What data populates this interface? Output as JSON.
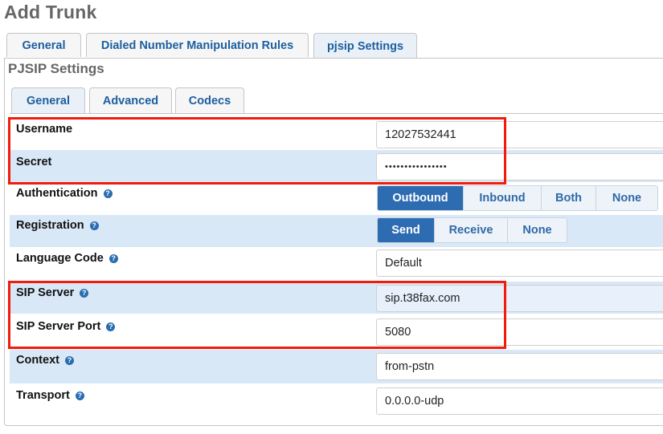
{
  "page": {
    "title": "Add Trunk"
  },
  "top_tabs": [
    {
      "label": "General",
      "active": false
    },
    {
      "label": "Dialed Number Manipulation Rules",
      "active": false
    },
    {
      "label": "pjsip Settings",
      "active": true
    }
  ],
  "section": {
    "title": "PJSIP Settings"
  },
  "inner_tabs": [
    {
      "label": "General",
      "active": true
    },
    {
      "label": "Advanced",
      "active": false
    },
    {
      "label": "Codecs",
      "active": false
    }
  ],
  "fields": {
    "username": {
      "label": "Username",
      "value": "12027532441"
    },
    "secret": {
      "label": "Secret",
      "value": "••••••••••••••••"
    },
    "authentication": {
      "label": "Authentication",
      "help": "?",
      "options": [
        "Outbound",
        "Inbound",
        "Both",
        "None"
      ],
      "selected": "Outbound"
    },
    "registration": {
      "label": "Registration",
      "help": "?",
      "options": [
        "Send",
        "Receive",
        "None"
      ],
      "selected": "Send"
    },
    "language_code": {
      "label": "Language Code",
      "help": "?",
      "value": "Default"
    },
    "sip_server": {
      "label": "SIP Server",
      "help": "?",
      "value": "sip.t38fax.com"
    },
    "sip_server_port": {
      "label": "SIP Server Port",
      "help": "?",
      "value": "5080"
    },
    "context": {
      "label": "Context",
      "help": "?",
      "value": "from-pstn"
    },
    "transport": {
      "label": "Transport",
      "help": "?",
      "value": "0.0.0.0-udp"
    }
  },
  "colors": {
    "accent": "#2e6cb2",
    "highlight_box": "#f21b0c",
    "row_alt": "#d9e8f7",
    "tab_text": "#1d5fa0"
  }
}
